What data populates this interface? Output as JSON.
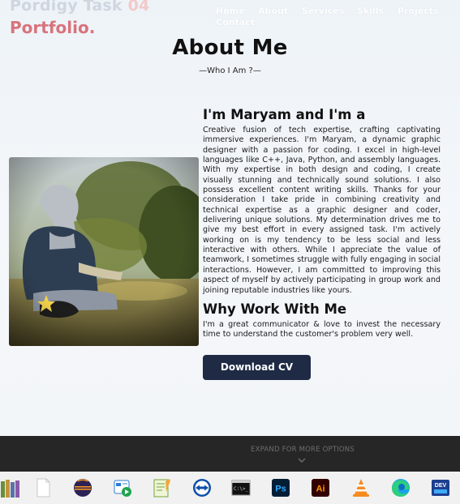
{
  "brand": {
    "task_prefix": "Pordigy Task",
    "task_suffix": " 04",
    "portfolio": "Portfolio",
    "portfolio_dot": "."
  },
  "nav": [
    "Home",
    "About",
    "Services",
    "Skills",
    "Projects",
    "Contact"
  ],
  "section": {
    "title": "About Me",
    "subtitle": "—Who I Am ?—"
  },
  "intro": {
    "heading": "I'm Maryam and I'm a",
    "paragraph": "Creative fusion of tech expertise, crafting captivating immersive experiences. I'm Maryam, a dynamic graphic designer with a passion for coding. I excel in high-level languages like C++, Java, Python, and assembly languages. With my expertise in both design and coding, I create visually stunning and technically sound solutions. I also possess excellent content writing skills. Thanks for your consideration I take pride in combining creativity and technical expertise as a graphic designer and coder, delivering unique solutions. My determination drives me to give my best effort in every assigned task. I'm actively working on is my tendency to be less social and less interactive with others. While I appreciate the value of teamwork, I sometimes struggle with fully engaging in social interactions. However, I am committed to improving this aspect of myself by actively participating in group work and joining reputable industries like yours."
  },
  "why": {
    "heading": "Why Work With Me",
    "paragraph": "I'm a great communicator & love to invest the necessary time to understand the customer's problem very well."
  },
  "cv_button": "Download CV",
  "expand_bar": {
    "label": "EXPAND FOR MORE OPTIONS"
  },
  "taskbar": {
    "icons": [
      "library-books-icon",
      "blank-document-icon",
      "eclipse-icon",
      "windows-media-player-icon",
      "notepad-plus-plus-icon",
      "teamviewer-icon",
      "command-prompt-icon",
      "photoshop-icon",
      "illustrator-icon",
      "vlc-icon",
      "edge-icon",
      "dev-cpp-icon"
    ],
    "labels": {
      "photoshop": "Ps",
      "illustrator": "Ai",
      "devcpp": "DEV",
      "cmd": "C:\\>_"
    }
  },
  "colors": {
    "accent_pink": "#d8737c",
    "button_navy": "#1f2a44",
    "dark_bar": "#262626",
    "taskbar": "#f1f1f1"
  }
}
